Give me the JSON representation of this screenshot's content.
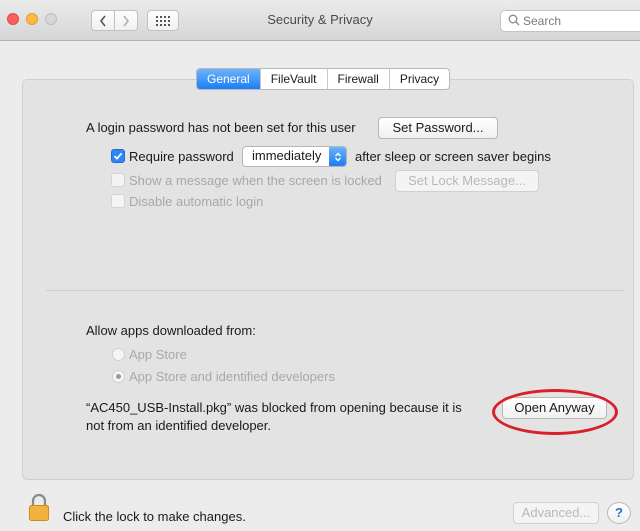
{
  "window": {
    "title": "Security & Privacy",
    "search_placeholder": "Search"
  },
  "tabs": [
    {
      "label": "General",
      "active": true
    },
    {
      "label": "FileVault",
      "active": false
    },
    {
      "label": "Firewall",
      "active": false
    },
    {
      "label": "Privacy",
      "active": false
    }
  ],
  "general": {
    "login_password_text": "A login password has not been set for this user",
    "set_password_label": "Set Password...",
    "require_password": {
      "label": "Require password",
      "checked": true
    },
    "require_password_select": "immediately",
    "after_sleep_text": "after sleep or screen saver begins",
    "show_message": {
      "label": "Show a message when the screen is locked",
      "checked": false,
      "enabled": false
    },
    "set_lock_message_label": "Set Lock Message...",
    "disable_auto_login": {
      "label": "Disable automatic login",
      "checked": false,
      "enabled": false
    }
  },
  "allow_apps": {
    "heading": "Allow apps downloaded from:",
    "options": [
      {
        "label": "App Store",
        "selected": false
      },
      {
        "label": "App Store and identified developers",
        "selected": true
      }
    ],
    "blocked_line1": "“AC450_USB-Install.pkg” was blocked from opening because it is",
    "blocked_line2": "not from an identified developer.",
    "open_anyway_label": "Open Anyway"
  },
  "footer": {
    "lock_text": "Click the lock to make changes.",
    "advanced_label": "Advanced...",
    "help_label": "?"
  },
  "colors": {
    "accent": "#1b7ef5",
    "highlight": "#d9202a"
  }
}
